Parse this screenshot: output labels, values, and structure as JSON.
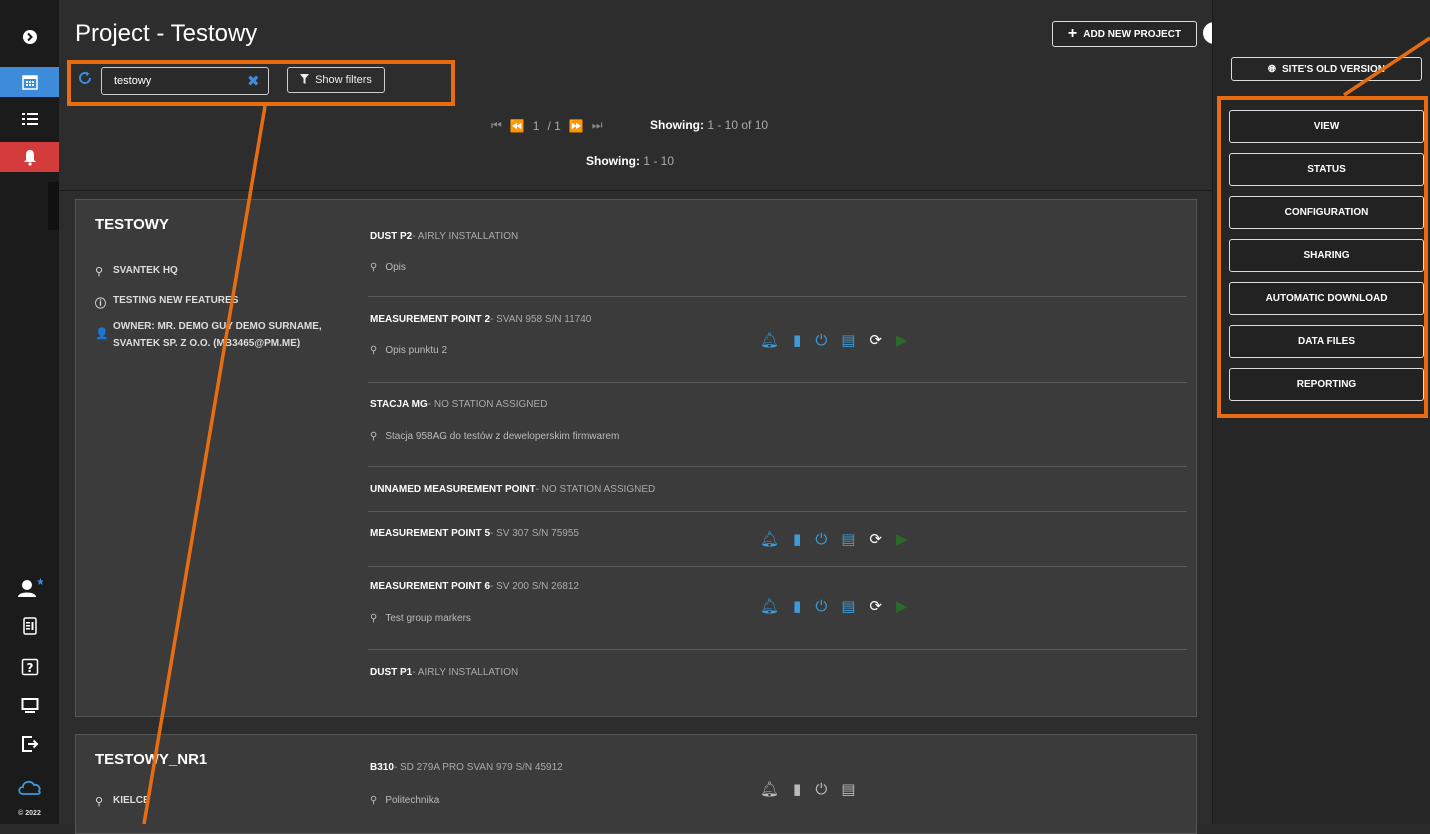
{
  "header": {
    "title": "Project - Testowy",
    "add_project": "ADD NEW PROJECT"
  },
  "search": {
    "value": "testowy",
    "filters_label": "Show filters"
  },
  "pager": {
    "current": "1",
    "total": "/ 1",
    "showing_label": "Showing:",
    "showing_range": "1 - 10 of 10",
    "showing2_label": "Showing:",
    "showing2_range": "1 - 10"
  },
  "projects": [
    {
      "name": "TESTOWY",
      "location": "SVANTEK HQ",
      "info": "TESTING NEW FEATURES",
      "owner": "OWNER: MR. DEMO GUY DEMO SURNAME, SVANTEK SP. Z O.O. (MB3465@PM.ME)",
      "points": [
        {
          "name": "DUST P2",
          "station": "- AIRLY INSTALLATION",
          "desc": "Opis"
        },
        {
          "name": "MEASUREMENT POINT 2",
          "station": "- SVAN 958 S/N 11740",
          "desc": "Opis punktu 2"
        },
        {
          "name": "STACJA MG",
          "station": "- NO STATION ASSIGNED",
          "desc": "Stacja 958AG do testów z deweloperskim firmwarem"
        },
        {
          "name": "UNNAMED MEASUREMENT POINT",
          "station": "- NO STATION ASSIGNED",
          "desc": ""
        },
        {
          "name": "MEASUREMENT POINT 5",
          "station": "- SV 307 S/N 75955",
          "desc": ""
        },
        {
          "name": "MEASUREMENT POINT 6",
          "station": "- SV 200 S/N 26812",
          "desc": "Test group markers"
        },
        {
          "name": "DUST P1",
          "station": "- AIRLY INSTALLATION",
          "desc": ""
        }
      ]
    },
    {
      "name": "TESTOWY_NR1",
      "location": "KIELCE",
      "points": [
        {
          "name": "B310",
          "station": "- SD 279A PRO SVAN 979 S/N 45912",
          "desc": "Politechnika"
        }
      ]
    }
  ],
  "right_panel": {
    "old_version": "SITE'S OLD VERSION",
    "menu": [
      "VIEW",
      "STATUS",
      "CONFIGURATION",
      "SHARING",
      "AUTOMATIC DOWNLOAD",
      "DATA FILES",
      "REPORTING"
    ]
  },
  "rail": {
    "copyright": "© 2022"
  },
  "colors": {
    "accent_blue": "#3d8bd9",
    "alert_red": "#d43b3b",
    "highlight_orange": "#e86d10"
  }
}
